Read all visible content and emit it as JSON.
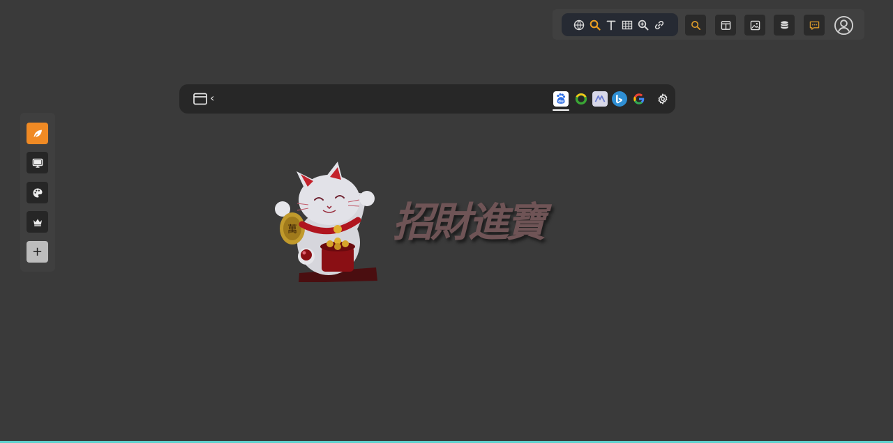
{
  "toolbar": {
    "tools": [
      {
        "name": "globe-icon"
      },
      {
        "name": "search-icon",
        "color": "#f0a020"
      },
      {
        "name": "text-icon"
      },
      {
        "name": "table-icon"
      },
      {
        "name": "zoom-in-icon"
      },
      {
        "name": "link-icon"
      }
    ],
    "buttons": [
      {
        "name": "search-button",
        "icon": "search-icon",
        "color": "#d99a2b"
      },
      {
        "name": "columns-button",
        "icon": "columns-icon"
      },
      {
        "name": "image-button",
        "icon": "image-icon"
      },
      {
        "name": "database-button",
        "icon": "database-icon"
      },
      {
        "name": "chat-button",
        "icon": "chat-icon",
        "color": "#d99a2b"
      },
      {
        "name": "account-button",
        "icon": "user-circle-icon"
      }
    ]
  },
  "sidebar": {
    "items": [
      {
        "name": "leaf-icon",
        "active": true,
        "color": "#f08a24"
      },
      {
        "name": "monitor-icon"
      },
      {
        "name": "palette-icon"
      },
      {
        "name": "crown-icon"
      },
      {
        "name": "plus-icon",
        "label": "+"
      }
    ]
  },
  "search_bar": {
    "back_glyph": "‹",
    "engines": [
      {
        "name": "baidu",
        "label": "du",
        "selected": true,
        "color": "#2f6fe4"
      },
      {
        "name": "360",
        "color": "#3aa635"
      },
      {
        "name": "metaso",
        "label": "Λ",
        "color": "#6a7bd0"
      },
      {
        "name": "bing",
        "label": "b",
        "color": "#2f8fd4"
      },
      {
        "name": "google",
        "label": "G",
        "color": "#4285f4"
      }
    ]
  },
  "logo": {
    "text": "招財進寶",
    "text_color": "#6f5456"
  },
  "accent_line_color": "#5fd0cd"
}
